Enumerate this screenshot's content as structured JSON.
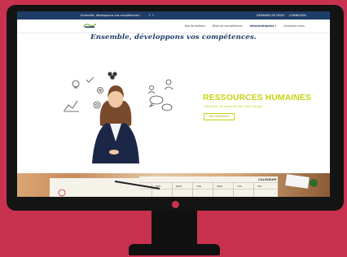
{
  "topbar": {
    "slogan": "Ensemble, développons vos compétences !",
    "social": "f  𝕥",
    "signup": "DEMANDE DE DEVIS",
    "login": "CONNEXION"
  },
  "nav": {
    "items": [
      {
        "label": "Nos formations",
        "active": false
      },
      {
        "label": "Bilan de compétences",
        "active": false
      },
      {
        "label": "Infos/entreprise ▾",
        "active": true
      },
      {
        "label": "Contactez-nous",
        "active": false
      }
    ]
  },
  "headline": "Ensemble, développons vos compétences.",
  "hero": {
    "title": "RESSOURCES HUMAINES",
    "subtitle": "Optimiser le potentiel de votre équipe",
    "button_label": "Nos formations"
  },
  "calendar": {
    "title": "CALENDAR",
    "days": [
      "SUN",
      "MON",
      "TUE",
      "WED",
      "THU",
      "FRI",
      "SAT"
    ]
  },
  "colors": {
    "accent": "#c7d214",
    "brand": "#1f3e67",
    "background": "#c9324e"
  }
}
